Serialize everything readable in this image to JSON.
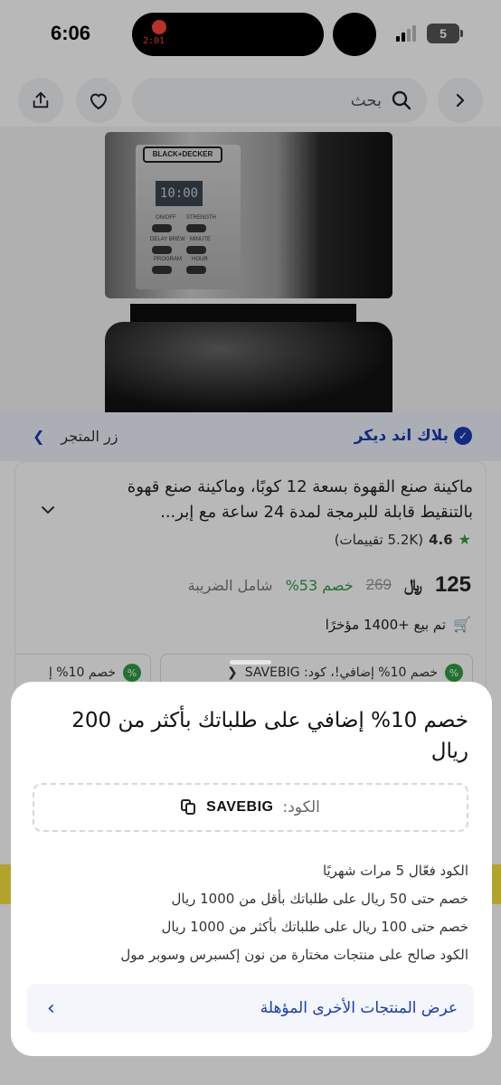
{
  "status_bar": {
    "time": "6:06",
    "timer": "2:01",
    "battery": "5"
  },
  "search": {
    "placeholder": "بحث"
  },
  "product_image": {
    "brand_plate": "BLACK+DECKER",
    "display": "10:00",
    "buttons": [
      "ON/OFF",
      "STRENGTH",
      "DELAY BREW",
      "MINUTE",
      "PROGRAM",
      "HOUR"
    ]
  },
  "store": {
    "name": "بلاك اند ديكر",
    "link_label": "زر المتجر"
  },
  "product": {
    "title": "ماكينة صنع القهوة بسعة 12 كوبًا، وماكينة صنع قهوة بالتنقيط قابلة للبرمجة لمدة 24 ساعة مع إبر...",
    "rating": "4.6",
    "reviews": "(5.2K تقييمات)",
    "price": "125",
    "currency": "﷼",
    "old_price": "269",
    "discount": "خصم 53%",
    "tax_note": "شامل الضريبة",
    "sold": "تم بيع +1400 مؤخرًا"
  },
  "coupons": [
    {
      "text": "خصم 10% إضافي!، كود: SAVEBIG"
    },
    {
      "text": "خصم 10% إ"
    }
  ],
  "sheet": {
    "title": "خصم 10% إضافي على طلباتك بأكثر من 200 ريال",
    "code_label": "الكود:",
    "code": "SAVEBIG",
    "terms": [
      "الكود فعّال 5 مرات شهريًا",
      "خصم حتى 50 ريال على طلباتك بأقل من 1000 ريال",
      "خصم حتى 100 ريال على طلباتك بأكثر من 1000 ريال",
      "الكود صالح على منتجات مختارة من نون إكسبرس وسوبر مول"
    ],
    "other_products_label": "عرض المنتجات الأخرى المؤهلة"
  },
  "colors": {
    "brand_blue": "#1a3bb3",
    "accent_green": "#2f9e44",
    "yellow_band": "#f7e23e"
  }
}
